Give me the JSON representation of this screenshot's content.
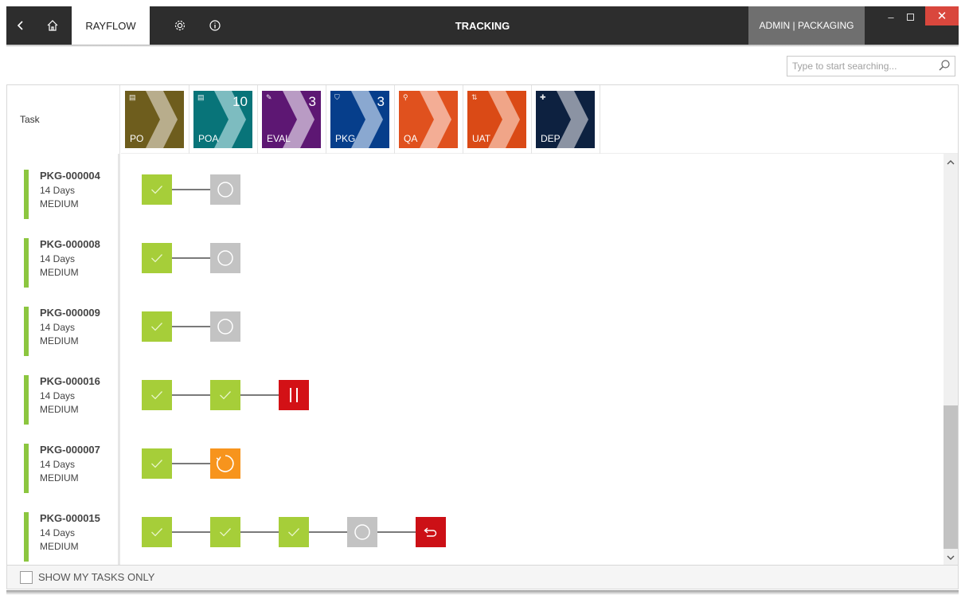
{
  "titlebar": {
    "app_tab": "RAYFLOW",
    "title": "TRACKING",
    "user": "ADMIN | PACKAGING",
    "icons": [
      "back-arrow",
      "home",
      "gear",
      "info"
    ]
  },
  "search": {
    "placeholder": "Type to start searching..."
  },
  "header": {
    "task_label": "Task"
  },
  "stages": [
    {
      "abbr": "PO",
      "count": "",
      "color": "#6e5d1d",
      "light": "#b8ad8c"
    },
    {
      "abbr": "POA",
      "count": "10",
      "color": "#087479",
      "light": "#7dbcc0"
    },
    {
      "abbr": "EVAL",
      "count": "3",
      "color": "#5d1773",
      "light": "#b99bc4"
    },
    {
      "abbr": "PKG",
      "count": "3",
      "color": "#063e8b",
      "light": "#8aa8d0"
    },
    {
      "abbr": "QA",
      "count": "",
      "color": "#e0511e",
      "light": "#f3ad95"
    },
    {
      "abbr": "UAT",
      "count": "",
      "color": "#da4a16",
      "light": "#f0a588"
    },
    {
      "abbr": "DEP",
      "count": "",
      "color": "#0d2140",
      "light": "#8b93a3"
    }
  ],
  "tasks": [
    {
      "id": "PKG-000004",
      "duration": "14 Days",
      "priority": "MEDIUM",
      "steps": [
        "done",
        "pending"
      ]
    },
    {
      "id": "PKG-000008",
      "duration": "14 Days",
      "priority": "MEDIUM",
      "steps": [
        "done",
        "pending"
      ]
    },
    {
      "id": "PKG-000009",
      "duration": "14 Days",
      "priority": "MEDIUM",
      "steps": [
        "done",
        "pending"
      ]
    },
    {
      "id": "PKG-000016",
      "duration": "14 Days",
      "priority": "MEDIUM",
      "steps": [
        "done",
        "done",
        "paused"
      ]
    },
    {
      "id": "PKG-000007",
      "duration": "14 Days",
      "priority": "MEDIUM",
      "steps": [
        "done",
        "running"
      ]
    },
    {
      "id": "PKG-000015",
      "duration": "14 Days",
      "priority": "MEDIUM",
      "steps": [
        "done",
        "done",
        "done",
        "pending",
        "returned"
      ]
    }
  ],
  "footer": {
    "show_my_tasks_label": "SHOW MY TASKS ONLY",
    "checked": false
  }
}
